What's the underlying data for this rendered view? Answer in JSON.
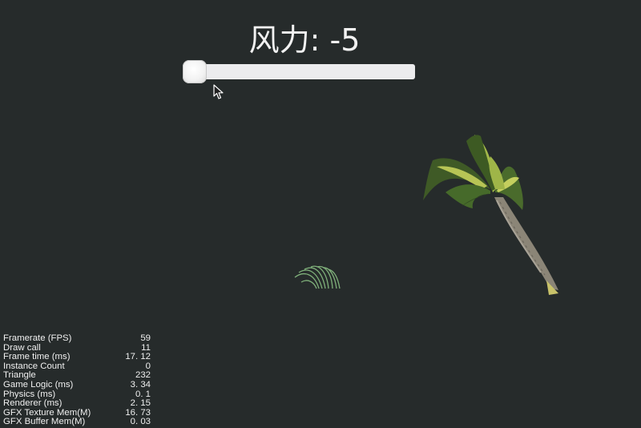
{
  "hud": {
    "wind_label": "风力: -5"
  },
  "wind_slider": {
    "min": -5,
    "max": 5,
    "value": -5
  },
  "scene": {
    "background_color": "#262b2b",
    "objects": [
      "palm-tree",
      "grass-tuft"
    ]
  },
  "stats": [
    {
      "label": "Framerate (FPS)",
      "value": "59"
    },
    {
      "label": "Draw call",
      "value": "11"
    },
    {
      "label": "Frame time (ms)",
      "value": "17. 12"
    },
    {
      "label": "Instance Count",
      "value": "0"
    },
    {
      "label": "Triangle",
      "value": "232"
    },
    {
      "label": "Game Logic (ms)",
      "value": "3. 34"
    },
    {
      "label": "Physics (ms)",
      "value": "0. 1"
    },
    {
      "label": "Renderer (ms)",
      "value": "2. 15"
    },
    {
      "label": "GFX Texture Mem(M)",
      "value": "16. 73"
    },
    {
      "label": "GFX Buffer Mem(M)",
      "value": "0. 03"
    }
  ]
}
